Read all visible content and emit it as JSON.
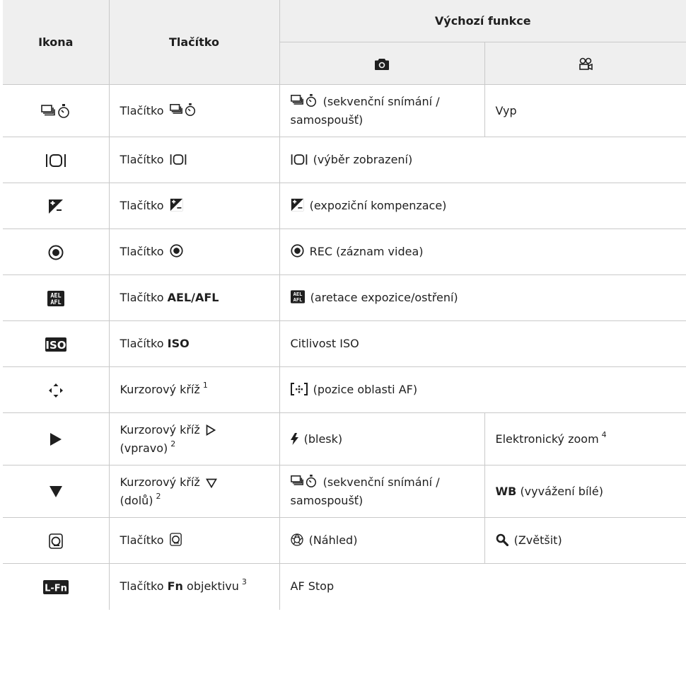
{
  "headers": {
    "icon": "Ikona",
    "button": "Tlačítko",
    "default_function": "Výchozí funkce"
  },
  "subheaders": {
    "photo_icon": "camera-icon",
    "video_icon": "movie-camera-icon"
  },
  "rows": [
    {
      "icon": "sequential-self-timer-icon",
      "button_prefix": "Tlačítko",
      "photo": "(sekvenční snímání / samospoušť)",
      "video": "Vyp"
    },
    {
      "icon": "display-select-icon",
      "button_prefix": "Tlačítko",
      "photo": "(výběr zobrazení)"
    },
    {
      "icon": "exposure-compensation-icon",
      "button_prefix": "Tlačítko",
      "photo": "(expoziční kompenzace)"
    },
    {
      "icon": "rec-icon",
      "button_prefix": "Tlačítko",
      "photo": "REC (záznam videa)"
    },
    {
      "icon": "ael-afl-icon",
      "button_prefix": "Tlačítko",
      "button_bold": "AEL/AFL",
      "photo": "(aretace expozice/ostření)"
    },
    {
      "icon": "iso-icon",
      "button_prefix": "Tlačítko",
      "button_bold": "ISO",
      "photo": "Citlivost ISO"
    },
    {
      "icon": "cursor-cross-icon",
      "button_prefix": "Kurzorový kříž",
      "button_sup": "1",
      "photo": "(pozice oblasti AF)"
    },
    {
      "icon": "play-right-icon",
      "button_prefix": "Kurzorový kříž",
      "button_suffix": "(vpravo)",
      "button_sup": "2",
      "photo": "(blesk)",
      "video": "Elektronický zoom",
      "video_sup": "4"
    },
    {
      "icon": "triangle-down-icon",
      "button_prefix": "Kurzorový kříž",
      "button_suffix": "(dolů)",
      "button_sup": "2",
      "photo": "(sekvenční snímání / samospoušť)",
      "video_bold": "WB",
      "video": "(vyvážení bílé)"
    },
    {
      "icon": "preview-button-icon",
      "button_prefix": "Tlačítko",
      "photo": "(Náhled)",
      "video": "(Zvětšit)"
    },
    {
      "icon": "lens-fn-icon",
      "button_prefix": "Tlačítko",
      "button_bold": "Fn",
      "button_suffix": "objektivu",
      "button_sup": "3",
      "photo": "AF Stop"
    }
  ]
}
